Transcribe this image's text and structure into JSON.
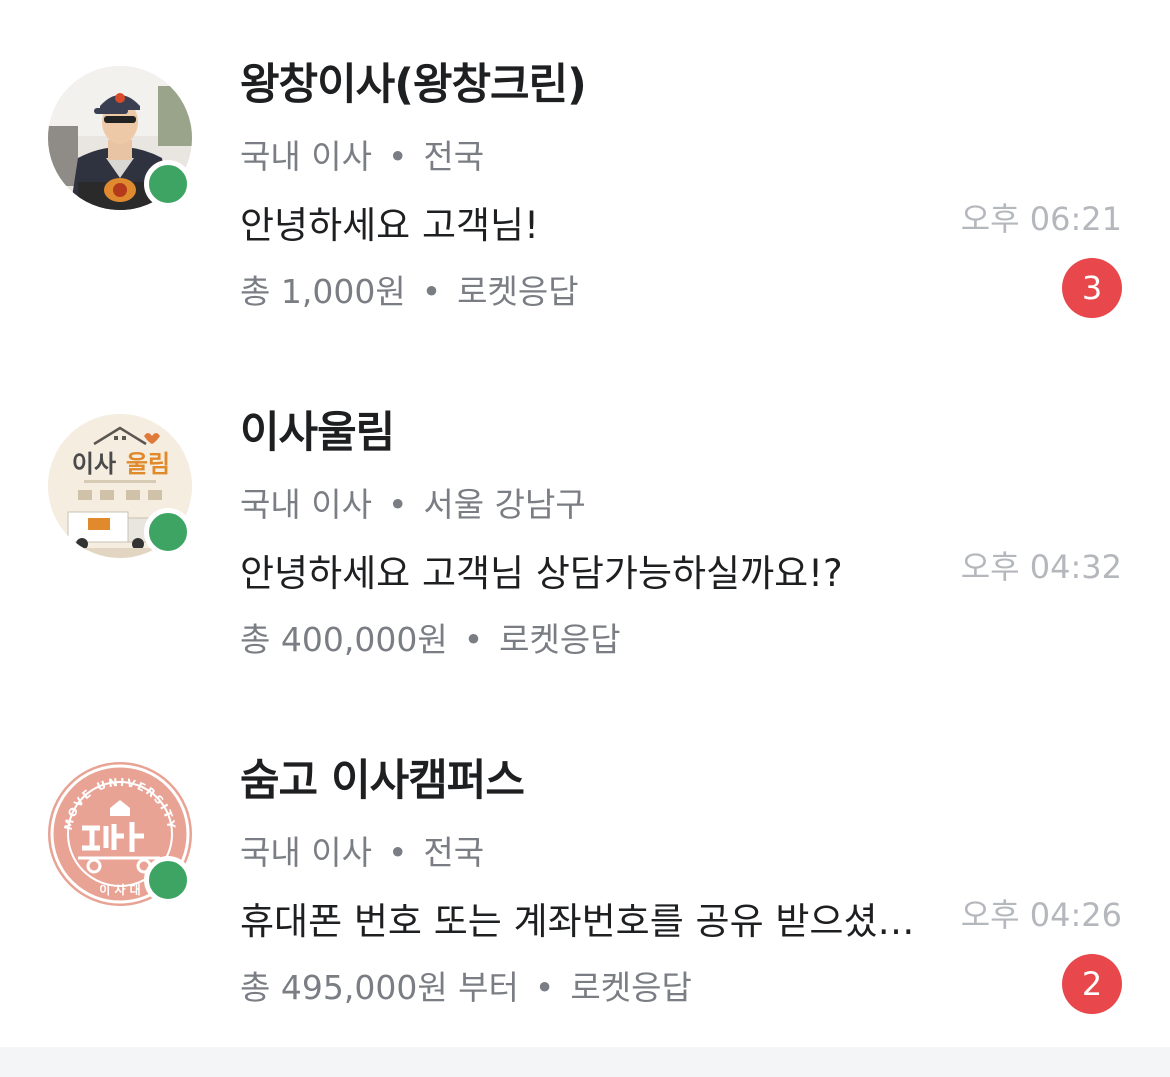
{
  "conversations": [
    {
      "name": "왕창이사(왕창크린)",
      "avatar_icon": "person-mover-photo",
      "category": "국내 이사",
      "region": "전국",
      "separator": "•",
      "message": "안녕하세요 고객님!",
      "time": "오후 06:21",
      "price": "총 1,000원",
      "response": "로켓응답",
      "unread": "3",
      "online": true
    },
    {
      "name": "이사울림",
      "avatar_icon": "iroolim-logo",
      "category": "국내 이사",
      "region": "서울 강남구",
      "separator": "•",
      "message": "안녕하세요 고객님 상담가능하실까요!?",
      "time": "오후 04:32",
      "price": "총 400,000원",
      "response": "로켓응답",
      "unread": null,
      "online": true
    },
    {
      "name": "숨고 이사캠퍼스",
      "avatar_icon": "move-university-logo",
      "category": "국내 이사",
      "region": "전국",
      "separator": "•",
      "message": "휴대폰 번호 또는 계좌번호를 공유 받으셨…",
      "time": "오후 04:26",
      "price": "총 495,000원 부터",
      "response": "로켓응답",
      "unread": "2",
      "online": true
    }
  ],
  "avatar_text": {
    "iroolim_line1": "이사",
    "iroolim_line2": "울림",
    "moveuniv_ring": "MOVE UNIVERSITY",
    "moveuniv_bottom": "이 사 대"
  },
  "colors": {
    "online": "#3da463",
    "badge": "#e8484b",
    "meta_text": "#7a7d83",
    "time_text": "#b4b7bc"
  }
}
